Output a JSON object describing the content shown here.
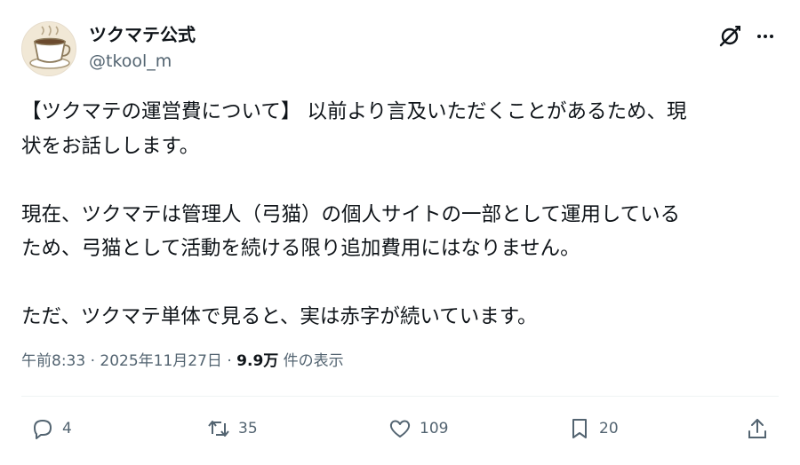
{
  "author": {
    "display_name": "ツクマテ公式",
    "handle": "@tkool_m",
    "avatar_icon": "coffee-cup-icon"
  },
  "post": {
    "lines": [
      "【ツクマテの運営費について】 以前より言及いただくことがあるため、現",
      "状をお話しします。",
      "",
      "現在、ツクマテは管理人（弓猫）の個人サイトの一部として運用している",
      "ため、弓猫として活動を続ける限り追加費用にはなりません。",
      "",
      "ただ、ツクマテ単体で見ると、実は赤字が続いています。"
    ]
  },
  "meta": {
    "time": "午前8:33",
    "separator": " · ",
    "date": "2025年11月27日",
    "views_count": "9.9万",
    "views_label": " 件の表示"
  },
  "actions": {
    "replies": "4",
    "reposts": "35",
    "likes": "109",
    "bookmarks": "20"
  },
  "colors": {
    "text": "#0f1419",
    "secondary": "#536471",
    "divider": "#eff3f4"
  }
}
